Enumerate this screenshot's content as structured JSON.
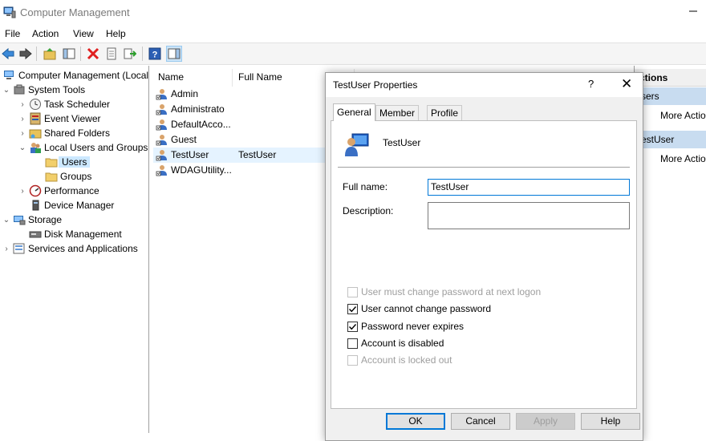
{
  "window": {
    "title": "Computer Management"
  },
  "menu": [
    "File",
    "Action",
    "View",
    "Help"
  ],
  "toolbar": {
    "icons": [
      "back-arrow-icon",
      "forward-arrow-icon",
      "up-folder-icon",
      "show-hide-tree-icon",
      "delete-icon",
      "properties-icon",
      "export-list-icon",
      "help-icon",
      "show-hide-action-pane-icon"
    ]
  },
  "tree": {
    "root": "Computer Management (Local",
    "system_tools": "System Tools",
    "task_scheduler": "Task Scheduler",
    "event_viewer": "Event Viewer",
    "shared_folders": "Shared Folders",
    "local_users_groups": "Local Users and Groups",
    "users": "Users",
    "groups": "Groups",
    "performance": "Performance",
    "device_manager": "Device Manager",
    "storage": "Storage",
    "disk_management": "Disk Management",
    "services_apps": "Services and Applications"
  },
  "list": {
    "columns": [
      "Name",
      "Full Name"
    ],
    "rows": [
      {
        "name": "Admin",
        "full": ""
      },
      {
        "name": "Administrato",
        "full": ""
      },
      {
        "name": "DefaultAcco...",
        "full": ""
      },
      {
        "name": "Guest",
        "full": ""
      },
      {
        "name": "TestUser",
        "full": "TestUser",
        "selected": true
      },
      {
        "name": "WDAGUtility...",
        "full": ""
      }
    ]
  },
  "actions": {
    "header": "ctions",
    "section1": "sers",
    "more1": "More Actio",
    "section2": "estUser",
    "more2": "More Actio"
  },
  "dialog": {
    "title": "TestUser Properties",
    "help": "?",
    "close": "✕",
    "tabs": [
      "General",
      "Member Of",
      "Profile"
    ],
    "username": "TestUser",
    "fullname_label": "Full name:",
    "fullname_value": "TestUser",
    "description_label": "Description:",
    "description_value": "",
    "checkboxes": [
      {
        "label": "User must change password at next logon",
        "checked": false,
        "disabled": true
      },
      {
        "label": "User cannot change password",
        "checked": true,
        "disabled": false
      },
      {
        "label": "Password never expires",
        "checked": true,
        "disabled": false
      },
      {
        "label": "Account is disabled",
        "checked": false,
        "disabled": false
      },
      {
        "label": "Account is locked out",
        "checked": false,
        "disabled": true
      }
    ],
    "buttons": {
      "ok": "OK",
      "cancel": "Cancel",
      "apply": "Apply",
      "help": "Help"
    }
  },
  "colors": {
    "accent": "#0078d7",
    "selection": "#cce8ff",
    "action_section": "#c8dcf0"
  }
}
